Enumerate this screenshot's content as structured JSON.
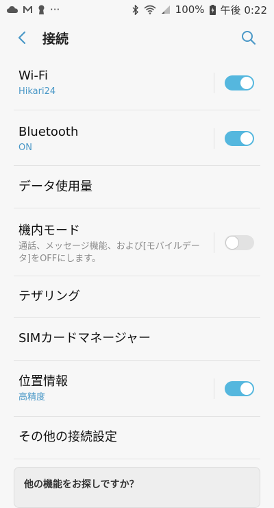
{
  "status_bar": {
    "battery": "100%",
    "time": "午後 0:22",
    "more": "···"
  },
  "header": {
    "title": "接続"
  },
  "items": [
    {
      "title": "Wi-Fi",
      "subtitle": "Hikari24",
      "toggle": "on"
    },
    {
      "title": "Bluetooth",
      "subtitle": "ON",
      "toggle": "on"
    },
    {
      "title": "データ使用量"
    },
    {
      "title": "機内モード",
      "description": "通話、メッセージ機能、および[モバイルデータ]をOFFにします。",
      "toggle": "off"
    },
    {
      "title": "テザリング"
    },
    {
      "title": "SIMカードマネージャー"
    },
    {
      "title": "位置情報",
      "subtitle": "高精度",
      "toggle": "on"
    },
    {
      "title": "その他の接続設定"
    }
  ],
  "hint_card": {
    "title": "他の機能をお探しですか？"
  },
  "colors": {
    "accent": "#55b7de",
    "subtitle": "#4a98c7",
    "background": "#f7f7f7"
  }
}
